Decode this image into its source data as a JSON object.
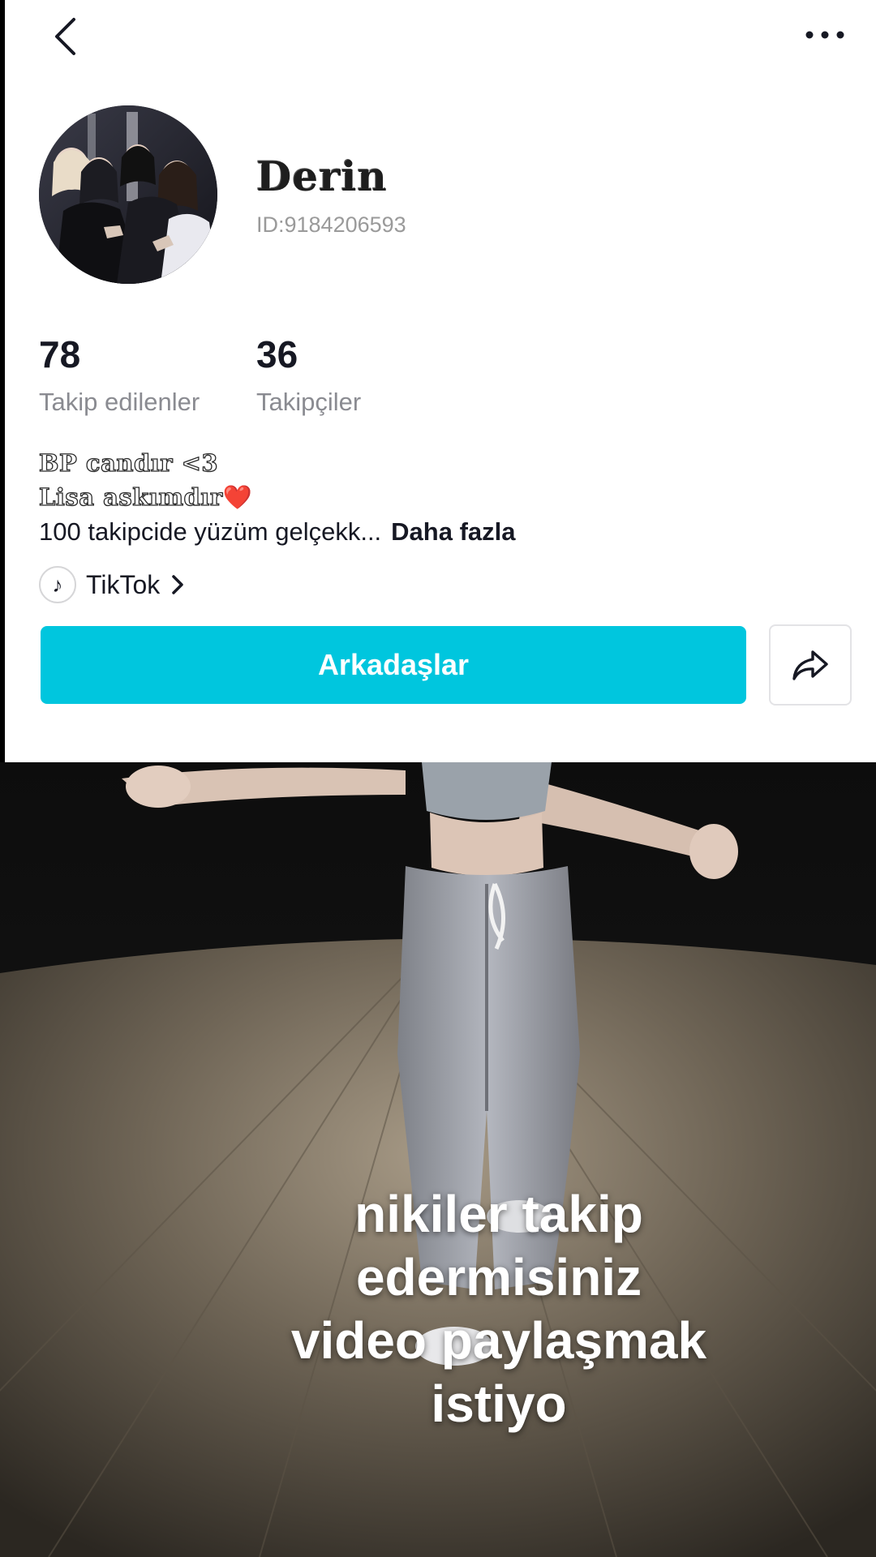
{
  "header": {
    "back_icon": "chevron-left-icon",
    "more_icon": "more-horizontal-icon"
  },
  "profile": {
    "username": "Derin",
    "id_text": "ID:9184206593",
    "following_count": "78",
    "following_label": "Takip edilenler",
    "followers_count": "36",
    "followers_label": "Takipçiler",
    "bio_line1": "BP candır <3",
    "bio_line2": "Lisa askımdır",
    "bio_line2_emoji": "❤️",
    "bio_line3": "100 takipcide yüzüm gelçekk...",
    "more_label": "Daha fazla",
    "link_label": "TikTok",
    "friends_button": "Arkadaşlar",
    "accent_color": "#00c6de"
  },
  "video": {
    "caption": "nikiler takip\nedermisiniz\nvideo paylaşmak\nistiyo"
  }
}
